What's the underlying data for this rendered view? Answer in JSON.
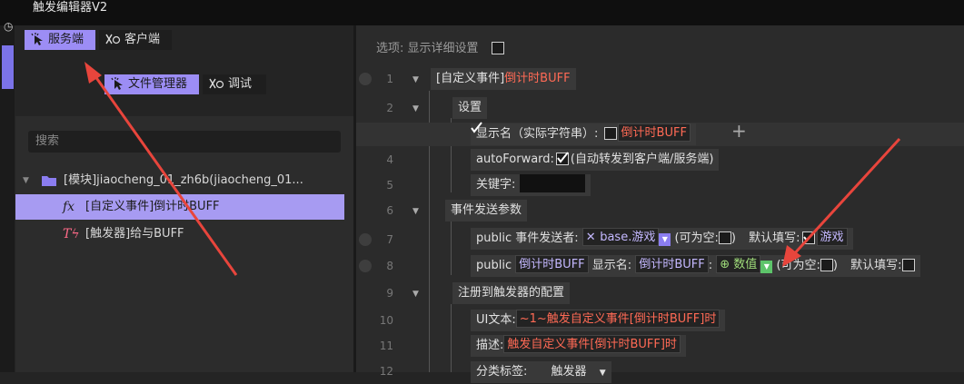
{
  "window": {
    "title": "触发编辑器V2"
  },
  "sidebar": {
    "tabs": [
      {
        "label": "服务端",
        "active": true
      },
      {
        "label": "客户端",
        "active": false
      }
    ],
    "subtabs": [
      {
        "label": "文件管理器",
        "active": true
      },
      {
        "label": "调试",
        "active": false
      }
    ],
    "search_placeholder": "搜索",
    "tree": [
      {
        "label": "[模块]jiaocheng_01_zh6b(jiaocheng_01...",
        "icon": "folder-icon"
      },
      {
        "label": "[自定义事件]倒计时BUFF",
        "icon": "fx-icon",
        "selected": true
      },
      {
        "label": "[触发器]给与BUFF",
        "icon": "trigger-icon"
      }
    ]
  },
  "main": {
    "options_label": "选项: 显示详细设置",
    "lines": [
      "1",
      "2",
      "3",
      "4",
      "5",
      "6",
      "7",
      "8",
      "9",
      "10",
      "11",
      "12"
    ],
    "root_prefix": "[自定义事件]",
    "root_name": "倒计时BUFF",
    "settings": "设置",
    "display_name_label": "显示名（实际字符串）:",
    "display_name_value": "倒计时BUFF",
    "plus": "+",
    "autoforward_label": "autoForward:",
    "autoforward_desc": "(自动转发到客户端/服务端)",
    "keyword_label": "关键字:",
    "params_label": "事件发送参数",
    "param1": {
      "prefix": "public 事件发送者:",
      "type": "base.游戏",
      "nullable": "(可为空:",
      "close": ")",
      "default_label": "默认填写:",
      "default_value": "游戏"
    },
    "param2": {
      "prefix": "public",
      "name": "倒计时BUFF",
      "display_label": "显示名:",
      "display_value": "倒计时BUFF",
      "colon": ":",
      "type": "数值",
      "nullable": "(可为空:",
      "close": ")",
      "default_label": "默认填写:"
    },
    "register_label": "注册到触发器的配置",
    "ui_text_label": "UI文本:",
    "ui_text_value": "~1~触发自定义事件[倒计时BUFF]时",
    "desc_label": "描述:",
    "desc_value": "触发自定义事件[倒计时BUFF]时",
    "category_label": "分类标签:",
    "category_value": "触发器"
  },
  "colors": {
    "accent": "#9c8df5",
    "highlight": "#ff6a55",
    "annotation": "#e8453c"
  }
}
